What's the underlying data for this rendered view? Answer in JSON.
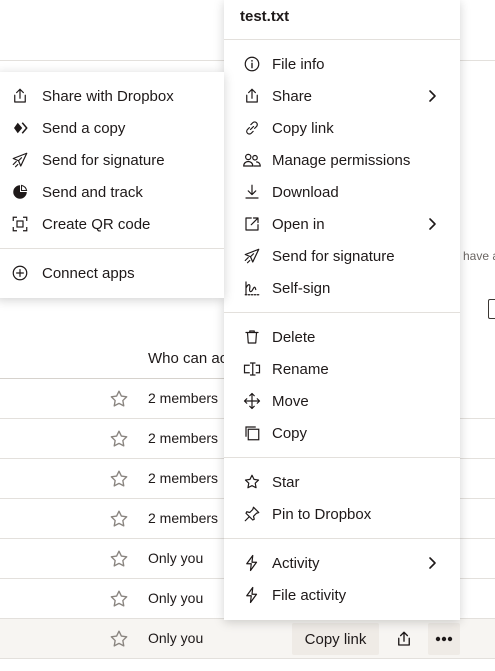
{
  "background": {
    "column_header": "Who can ac",
    "hint_text": "have a",
    "rows": [
      {
        "access": "2 members"
      },
      {
        "access": "2 members"
      },
      {
        "access": "2 members"
      },
      {
        "access": "2 members"
      },
      {
        "access": "Only you"
      },
      {
        "access": "Only you"
      },
      {
        "access": "Only you"
      }
    ],
    "selected_row_actions": {
      "copy_link_label": "Copy link",
      "share_icon": "share-icon",
      "more_icon": "more-icon"
    }
  },
  "main_menu": {
    "title": "test.txt",
    "groups": [
      [
        {
          "label": "File info",
          "icon": "info-icon"
        },
        {
          "label": "Share",
          "icon": "share-icon",
          "submenu": true
        },
        {
          "label": "Copy link",
          "icon": "link-icon"
        },
        {
          "label": "Manage permissions",
          "icon": "people-icon"
        },
        {
          "label": "Download",
          "icon": "download-icon"
        },
        {
          "label": "Open in",
          "icon": "open-in-icon",
          "submenu": true
        },
        {
          "label": "Send for signature",
          "icon": "paper-plane-icon"
        },
        {
          "label": "Self-sign",
          "icon": "signature-icon"
        }
      ],
      [
        {
          "label": "Delete",
          "icon": "trash-icon"
        },
        {
          "label": "Rename",
          "icon": "rename-icon"
        },
        {
          "label": "Move",
          "icon": "move-icon"
        },
        {
          "label": "Copy",
          "icon": "copy-icon"
        }
      ],
      [
        {
          "label": "Star",
          "icon": "star-icon"
        },
        {
          "label": "Pin to Dropbox",
          "icon": "pin-icon"
        }
      ],
      [
        {
          "label": "Activity",
          "icon": "lightning-icon",
          "submenu": true
        },
        {
          "label": "File activity",
          "icon": "lightning-icon"
        }
      ]
    ]
  },
  "share_submenu": {
    "items": [
      {
        "label": "Share with Dropbox",
        "icon": "share-icon"
      },
      {
        "label": "Send a copy",
        "icon": "transfer-icon"
      },
      {
        "label": "Send for signature",
        "icon": "paper-plane-icon"
      },
      {
        "label": "Send and track",
        "icon": "pie-chart-icon"
      },
      {
        "label": "Create QR code",
        "icon": "qr-code-icon"
      }
    ],
    "footer": [
      {
        "label": "Connect apps",
        "icon": "plus-circle-icon"
      }
    ]
  }
}
